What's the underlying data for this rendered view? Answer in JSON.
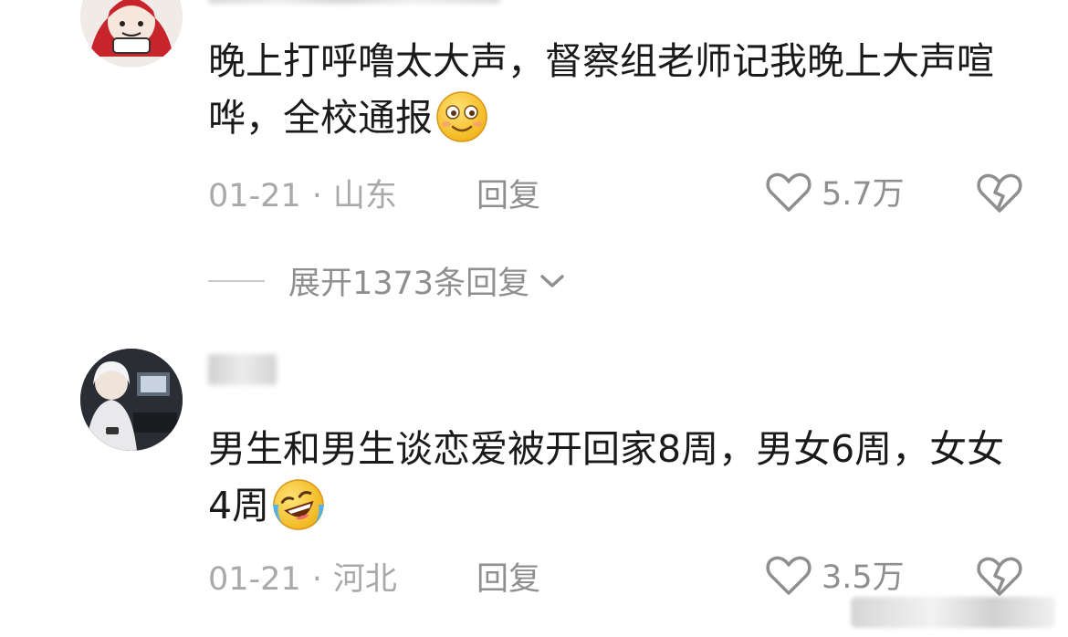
{
  "comments": [
    {
      "text": "晚上打呼噜太大声，督察组老师记我晚上大声喧哗，全校通报",
      "emoji_icon": "shy-smile-emoji",
      "date": "01-21",
      "separator": "·",
      "location": "山东",
      "reply_label": "回复",
      "like_count": "5.7万",
      "expand_label": "展开1373条回复"
    },
    {
      "text": "男生和男生谈恋爱被开回家8周，男女6周，女女4周",
      "emoji_icon": "laughing-tears-emoji",
      "date": "01-21",
      "separator": "·",
      "location": "河北",
      "reply_label": "回复",
      "like_count": "3.5万"
    }
  ],
  "colors": {
    "text_primary": "#1a1a1a",
    "text_meta": "#a9a9a9",
    "text_action": "#8f8f8f",
    "emoji_yellow": "#f7c531"
  }
}
